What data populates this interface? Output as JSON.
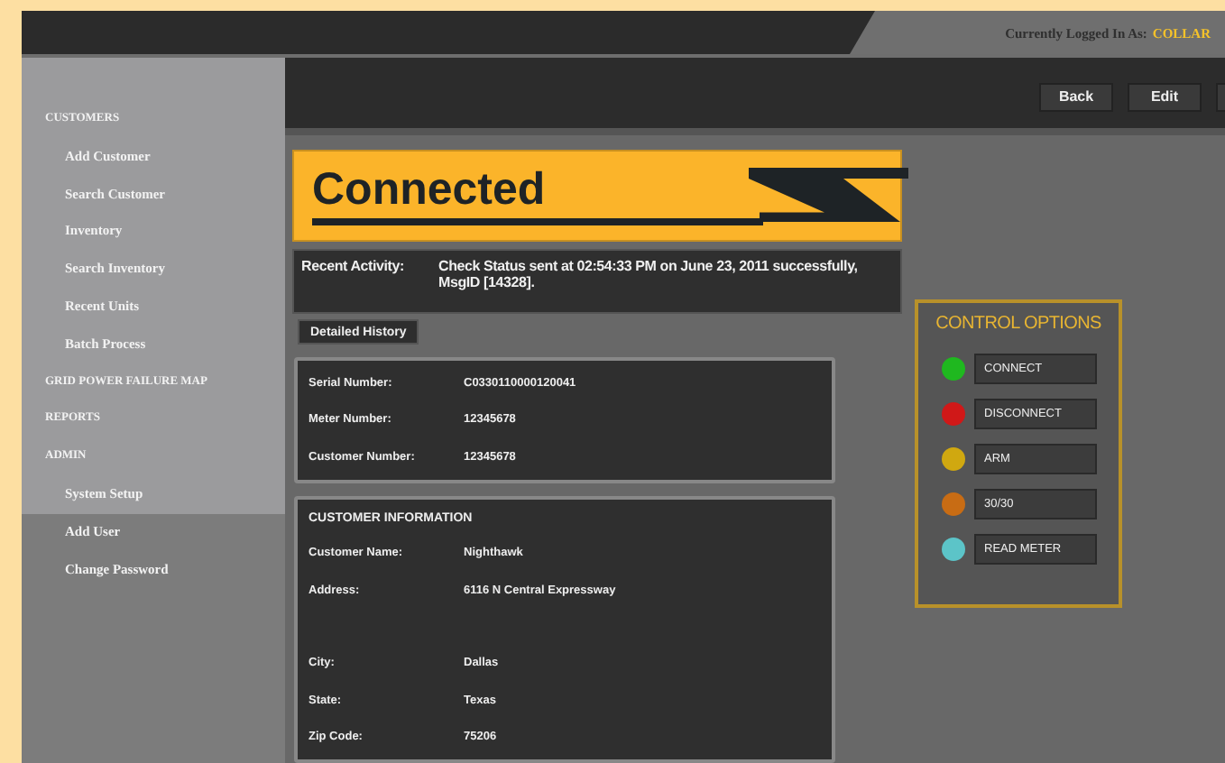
{
  "header": {
    "login_label": "Currently Logged In As:",
    "login_user": "COLLAR"
  },
  "sidebar": {
    "sections": [
      {
        "label": "CUSTOMERS",
        "children": [
          {
            "label": "Add Customer"
          },
          {
            "label": "Search Customer"
          },
          {
            "label": "Inventory"
          },
          {
            "label": "Search Inventory"
          },
          {
            "label": "Recent Units"
          },
          {
            "label": "Batch Process"
          }
        ]
      },
      {
        "label": "GRID POWER FAILURE MAP"
      },
      {
        "label": "REPORTS"
      },
      {
        "label": "ADMIN",
        "children": [
          {
            "label": "System Setup"
          },
          {
            "label": "Add User"
          },
          {
            "label": "Change Password"
          }
        ]
      }
    ]
  },
  "toolbar": {
    "buttons": [
      "Back",
      "Edit"
    ]
  },
  "status_banner": {
    "title": "Connected"
  },
  "recent_activity": {
    "label": "Recent Activity:",
    "message": "Check Status sent at 02:54:33 PM on June 23, 2011 successfully, MsgID [14328]."
  },
  "detailed_history_button": "Detailed History",
  "meter_card": {
    "fields": [
      {
        "label": "Serial Number:",
        "value": "C0330110000120041"
      },
      {
        "label": "Meter Number:",
        "value": "12345678"
      },
      {
        "label": "Customer Number:",
        "value": "12345678"
      }
    ]
  },
  "customer_card": {
    "title": "CUSTOMER INFORMATION",
    "fields": [
      {
        "label": "Customer Name:",
        "value": "Nighthawk"
      },
      {
        "label": "Address:",
        "value": "6116 N Central Expressway"
      },
      {
        "label": "City:",
        "value": "Dallas"
      },
      {
        "label": "State:",
        "value": "Texas"
      },
      {
        "label": "Zip Code:",
        "value": "75206"
      }
    ]
  },
  "control_options": {
    "title": "CONTROL OPTIONS",
    "items": [
      {
        "label": "CONNECT",
        "color": "#1fb81f"
      },
      {
        "label": "DISCONNECT",
        "color": "#d01818"
      },
      {
        "label": "ARM",
        "color": "#d0a810"
      },
      {
        "label": "30/30",
        "color": "#c86c14"
      },
      {
        "label": "READ METER",
        "color": "#5cc4c8"
      }
    ]
  }
}
